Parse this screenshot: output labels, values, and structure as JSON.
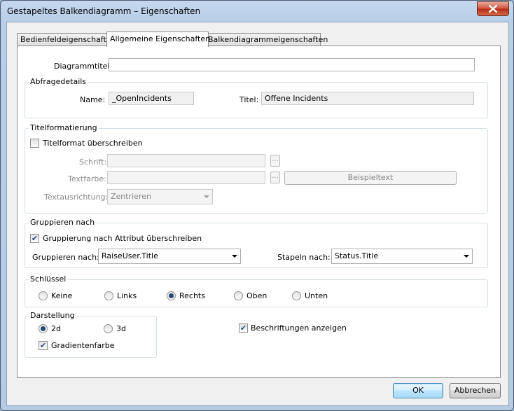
{
  "window": {
    "title": "Gestapeltes Balkendiagramm – Eigenschaften"
  },
  "tabs": [
    {
      "label": "Bedienfeldeigenschaften"
    },
    {
      "label": "Allgemeine Eigenschaften"
    },
    {
      "label": "Balkendiagrammeigenschaften"
    }
  ],
  "active_tab": 1,
  "general": {
    "chart_title_label": "Diagrammtitel",
    "chart_title_value": ""
  },
  "query": {
    "group_title": "Abfragedetails",
    "name_label": "Name:",
    "name_value": "_OpenIncidents",
    "title_label": "Titel:",
    "title_value": "Offene Incidents"
  },
  "title_format": {
    "group_title": "Titelformatierung",
    "override_label": "Titelformat überschreiben",
    "override_checked": false,
    "font_label": "Schrift:",
    "font_value": "",
    "ellipsis": "...",
    "color_label": "Textfarbe:",
    "color_value": "",
    "sample_button": "Beispieltext",
    "align_label": "Textausrichtung:",
    "align_value": "Zentrieren"
  },
  "grouping": {
    "group_title": "Gruppieren nach",
    "override_label": "Gruppierung nach Attribut überschreiben",
    "override_checked": true,
    "group_by_label": "Gruppieren nach:",
    "group_by_value": "RaiseUser.Title",
    "stack_by_label": "Stapeln nach:",
    "stack_by_value": "Status.Title"
  },
  "legend": {
    "group_title": "Schlüssel",
    "options": [
      "Keine",
      "Links",
      "Rechts",
      "Oben",
      "Unten"
    ],
    "selected": "Rechts"
  },
  "display": {
    "group_title": "Darstellung",
    "opt_2d": "2d",
    "opt_3d": "3d",
    "selected": "2d",
    "gradient_label": "Gradientenfarbe",
    "gradient_checked": true,
    "show_labels_label": "Beschriftungen anzeigen",
    "show_labels_checked": true
  },
  "footer": {
    "ok_label": "OK",
    "cancel_label": "Abbrechen"
  },
  "colors": {
    "title_bar": "#b9cfe8",
    "close_button": "#c7432b",
    "panel_bg": "#ffffff",
    "dialog_bg": "#f0f0f0"
  }
}
